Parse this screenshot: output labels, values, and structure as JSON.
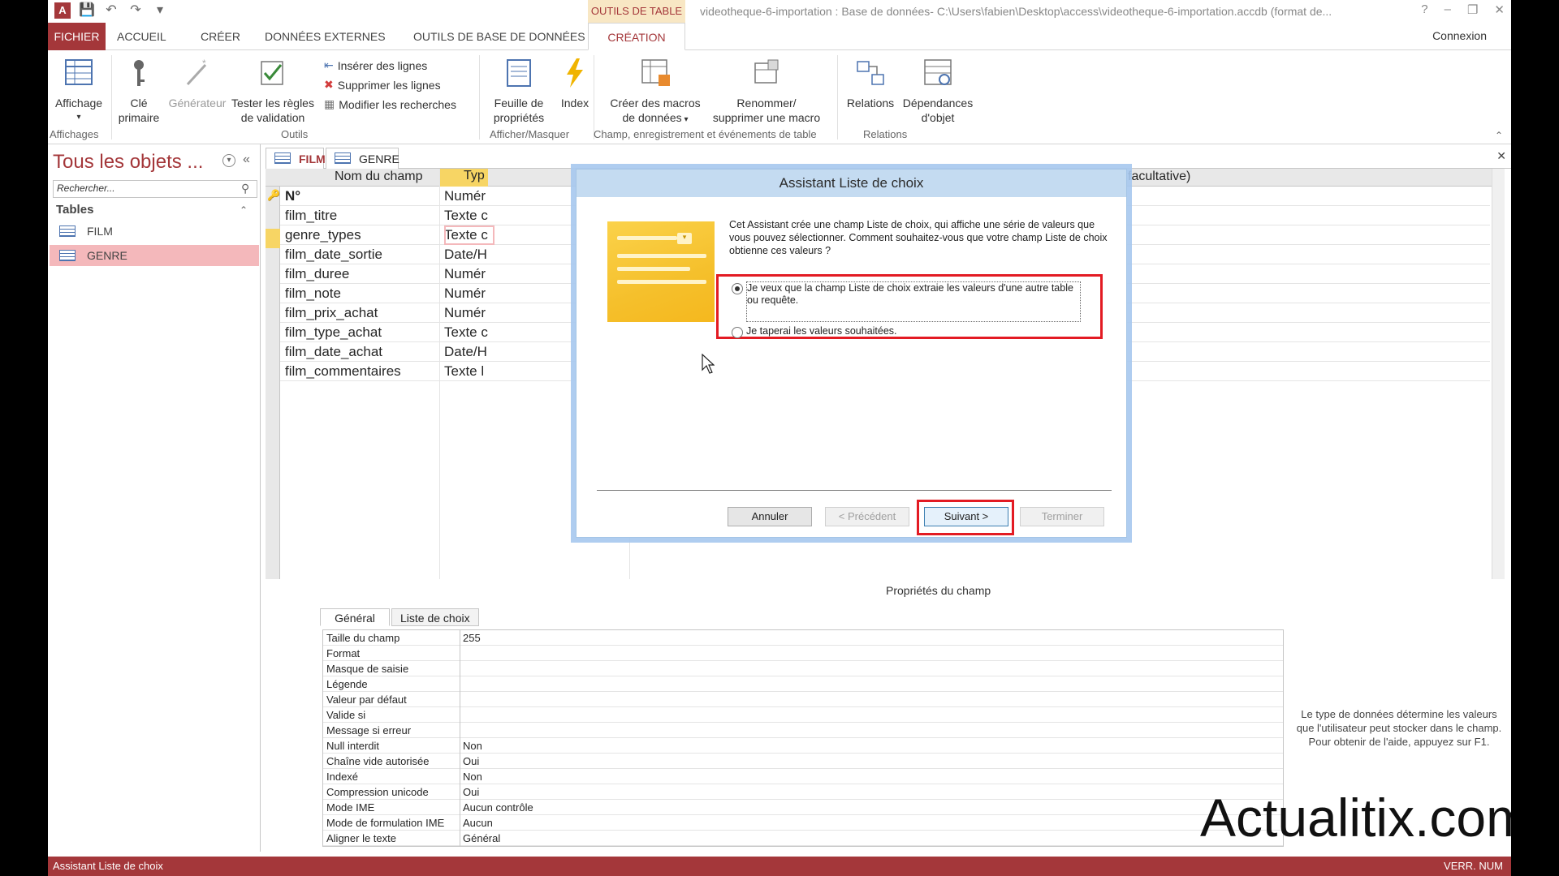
{
  "titlebar": {
    "context_tab": "OUTILS DE TABLE",
    "window_title": "videotheque-6-importation : Base de données- C:\\Users\\fabien\\Desktop\\access\\videotheque-6-importation.accdb (format de...",
    "app_icon": "A"
  },
  "tabs": [
    "FICHIER",
    "ACCUEIL",
    "CRÉER",
    "DONNÉES EXTERNES",
    "OUTILS DE BASE DE DONNÉES",
    "CRÉATION"
  ],
  "connexion": "Connexion",
  "ribbon": {
    "affichage": "Affichage",
    "cle": "Clé",
    "primaire": "primaire",
    "generateur": "Générateur",
    "tester1": "Tester les règles",
    "tester2": "de validation",
    "inserer": "Insérer des lignes",
    "supprimer": "Supprimer les lignes",
    "modifier": "Modifier les recherches",
    "feuille1": "Feuille de",
    "feuille2": "propriétés",
    "index": "Index",
    "creer1": "Créer des macros",
    "creer2": "de données",
    "renommer1": "Renommer/",
    "renommer2": "supprimer une macro",
    "relations": "Relations",
    "dep1": "Dépendances",
    "dep2": "d'objet",
    "groups": {
      "affichages": "Affichages",
      "outils": "Outils",
      "afficher": "Afficher/Masquer",
      "champ": "Champ, enregistrement et événements de table",
      "relations": "Relations"
    }
  },
  "nav": {
    "title": "Tous les objets ...",
    "search_placeholder": "Rechercher...",
    "section": "Tables",
    "items": [
      "FILM",
      "GENRE"
    ]
  },
  "doc_tabs": [
    "FILM",
    "GENRE"
  ],
  "grid": {
    "col1": "Nom du champ",
    "col2": "Typ",
    "col3": "facultative)",
    "rows": [
      {
        "name": "N°",
        "type": "Numér"
      },
      {
        "name": "film_titre",
        "type": "Texte c"
      },
      {
        "name": "genre_types",
        "type": "Texte c"
      },
      {
        "name": "film_date_sortie",
        "type": "Date/H"
      },
      {
        "name": "film_duree",
        "type": "Numér"
      },
      {
        "name": "film_note",
        "type": "Numér"
      },
      {
        "name": "film_prix_achat",
        "type": "Numér"
      },
      {
        "name": "film_type_achat",
        "type": "Texte c"
      },
      {
        "name": "film_date_achat",
        "type": "Date/H"
      },
      {
        "name": "film_commentaires",
        "type": "Texte l"
      }
    ]
  },
  "props": {
    "title": "Propriétés du champ",
    "tabs": [
      "Général",
      "Liste de choix"
    ],
    "rows": [
      {
        "k": "Taille du champ",
        "v": "255"
      },
      {
        "k": "Format",
        "v": ""
      },
      {
        "k": "Masque de saisie",
        "v": ""
      },
      {
        "k": "Légende",
        "v": ""
      },
      {
        "k": "Valeur par défaut",
        "v": ""
      },
      {
        "k": "Valide si",
        "v": ""
      },
      {
        "k": "Message si erreur",
        "v": ""
      },
      {
        "k": "Null interdit",
        "v": "Non"
      },
      {
        "k": "Chaîne vide autorisée",
        "v": "Oui"
      },
      {
        "k": "Indexé",
        "v": "Non"
      },
      {
        "k": "Compression unicode",
        "v": "Oui"
      },
      {
        "k": "Mode IME",
        "v": "Aucun contrôle"
      },
      {
        "k": "Mode de formulation IME",
        "v": "Aucun"
      },
      {
        "k": "Aligner le texte",
        "v": "Général"
      }
    ],
    "help": "Le type de données détermine les valeurs que l'utilisateur peut stocker dans le champ. Pour obtenir de l'aide, appuyez sur F1."
  },
  "dialog": {
    "title": "Assistant Liste de choix",
    "description": "Cet Assistant crée une champ Liste de choix, qui affiche une série de valeurs que vous pouvez sélectionner. Comment souhaitez-vous que votre champ Liste de choix obtienne ces valeurs ?",
    "option1": "Je veux que la champ Liste de choix extraie les valeurs d'une autre table ou requête.",
    "option2": "Je taperai les valeurs souhaitées.",
    "btn_cancel": "Annuler",
    "btn_prev": "< Précédent",
    "btn_next": "Suivant >",
    "btn_finish": "Terminer"
  },
  "watermark": "Actualitix.com",
  "status": {
    "left": "Assistant Liste de choix",
    "right": "VERR. NUM"
  },
  "colors": {
    "accent": "#a4373a",
    "highlight": "#e31b23",
    "selected_nav": "#f4b8bb"
  }
}
